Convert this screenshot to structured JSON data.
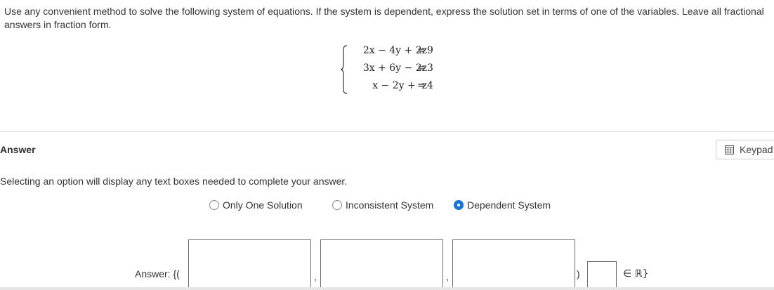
{
  "question": {
    "text": "Use any convenient method to solve the following system of equations. If the system is dependent, express the solution set in terms of one of the variables. Leave all fractional answers in fraction form."
  },
  "system": {
    "equations": [
      {
        "lhs": "2x − 4y + 2z",
        "eq": "=",
        "rhs": "9"
      },
      {
        "lhs": "3x + 6y − 2z",
        "eq": "=",
        "rhs": "3"
      },
      {
        "lhs": "x − 2y +  z",
        "eq": "=",
        "rhs": "4"
      }
    ]
  },
  "answer_section": {
    "title": "Answer",
    "keypad_label": "Keypad",
    "instruction": "Selecting an option will display any text boxes needed to complete your answer.",
    "options": [
      {
        "label": "Only One Solution",
        "selected": false
      },
      {
        "label": "Inconsistent System",
        "selected": false
      },
      {
        "label": "Dependent System",
        "selected": true
      }
    ]
  },
  "answer_row": {
    "prefix": "Answer: {(",
    "separator": ",",
    "close_paren": ")",
    "tail": "∈ ℝ}",
    "inputs": [
      {
        "value": ""
      },
      {
        "value": ""
      },
      {
        "value": ""
      },
      {
        "value": ""
      }
    ]
  },
  "colors": {
    "accent": "#1a73d6",
    "text": "#333333",
    "border": "#6b6b6b"
  }
}
